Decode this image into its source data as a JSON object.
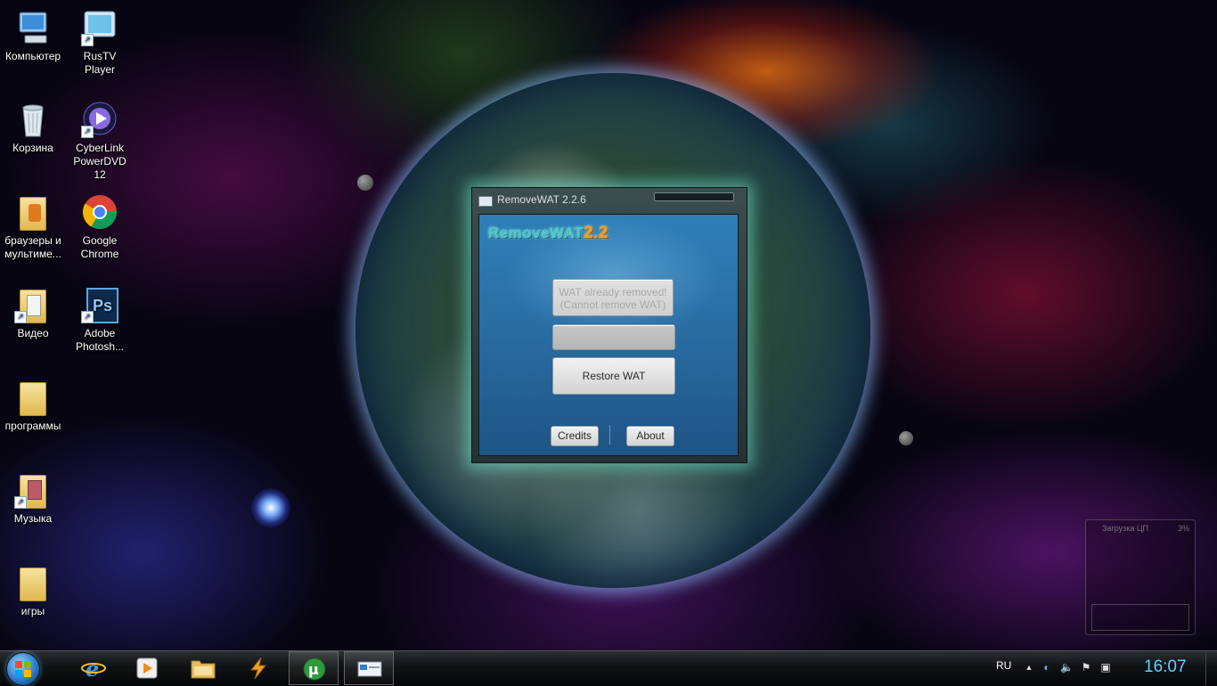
{
  "desktop": {
    "icons": [
      {
        "label": "Компьютер"
      },
      {
        "label": "RusTV Player"
      },
      {
        "label": "Корзина"
      },
      {
        "label": "CyberLink PowerDVD 12"
      },
      {
        "label": "браузеры и мультиме..."
      },
      {
        "label": "Google Chrome"
      },
      {
        "label": "Видео"
      },
      {
        "label": "Adobe Photosh..."
      },
      {
        "label": "программы"
      },
      {
        "label": "Музыка"
      },
      {
        "label": "игры"
      }
    ]
  },
  "window": {
    "title": "RemoveWAT 2.2.6",
    "logo_text": "RemoveWAT",
    "logo_version": "2.2",
    "remove_button": {
      "line1": "WAT already removed!",
      "line2": "(Cannot remove WAT)"
    },
    "restore_button": "Restore WAT",
    "credits_button": "Credits",
    "about_button": "About"
  },
  "gadget": {
    "title": "Загрузка ЦП",
    "percent": "3%"
  },
  "taskbar": {
    "language": "RU",
    "clock": "16:07"
  },
  "colors": {
    "accent": "#2f7fb8",
    "clock": "#5fd0ff",
    "logo": "#4ec8c8",
    "logo_version": "#f0a020"
  }
}
